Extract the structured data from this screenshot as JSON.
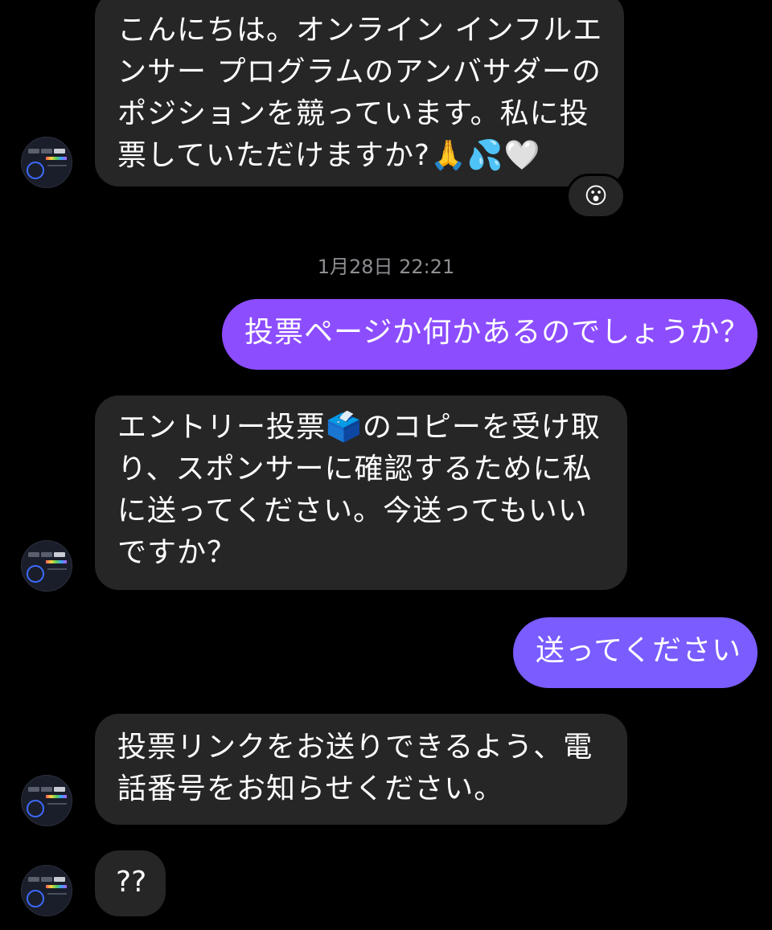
{
  "messages": [
    {
      "text": "こんにちは。オンライン インフルエンサー プログラムのアンバサダーのポジションを競っています。私に投票していただけますか?🙏💦🤍",
      "reaction": "😮"
    },
    {
      "timestamp": "1月28日 22:21"
    },
    {
      "text": "投票ページか何かあるのでしょうか？"
    },
    {
      "text": "エントリー投票🗳️のコピーを受け取り、スポンサーに確認するために私に送ってください。今送ってもいいですか？"
    },
    {
      "text": "送ってください"
    },
    {
      "text": "投票リンクをお送りできるよう、電話番号をお知らせください。"
    },
    {
      "text": "??"
    }
  ],
  "colors": {
    "incoming_bubble": "#262626",
    "outgoing_top": "#8c4dff",
    "outgoing_bottom": "#7a5cff",
    "timestamp": "#8e8e93"
  }
}
